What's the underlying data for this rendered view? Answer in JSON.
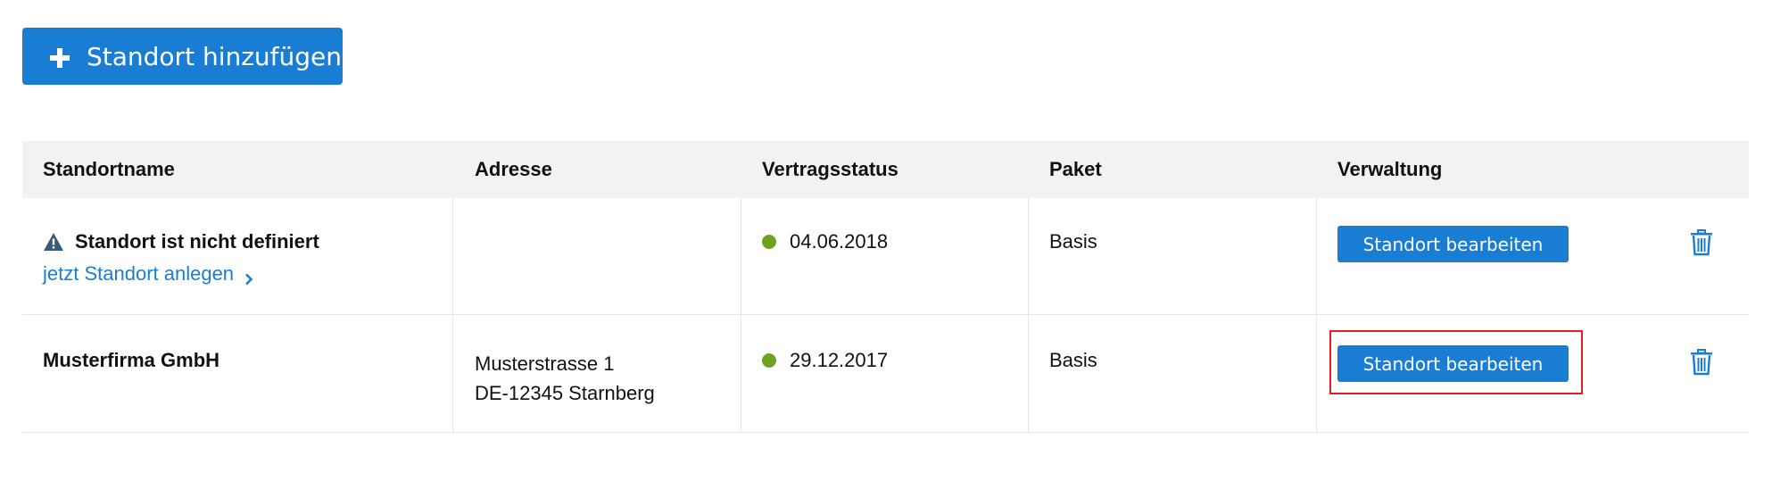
{
  "toolbar": {
    "add_label": "Standort hinzufügen"
  },
  "table": {
    "headers": [
      "Standortname",
      "Adresse",
      "Vertragsstatus",
      "Paket",
      "Verwaltung"
    ],
    "rows": [
      {
        "name": "Standort ist nicht definiert",
        "name_link": "jetzt Standort anlegen",
        "address_line1": "",
        "address_line2": "",
        "status_date": "04.06.2018",
        "package": "Basis",
        "edit_label": "Standort bearbeiten"
      },
      {
        "name": "Musterfirma GmbH",
        "name_link": "",
        "address_line1": "Musterstrasse 1",
        "address_line2": "DE-12345 Starnberg",
        "status_date": "29.12.2017",
        "package": "Basis",
        "edit_label": "Standort bearbeiten"
      }
    ]
  },
  "colors": {
    "primary": "#1a7dd4",
    "status_active": "#6fa31f",
    "header_bg": "#f1f2f4",
    "warning_icon": "#3a5a7a",
    "highlight": "#e02020"
  },
  "icons": {
    "add": "plus-icon",
    "warning": "warning-icon",
    "link_arrow": "chevron-right-icon",
    "delete": "trash-icon"
  }
}
